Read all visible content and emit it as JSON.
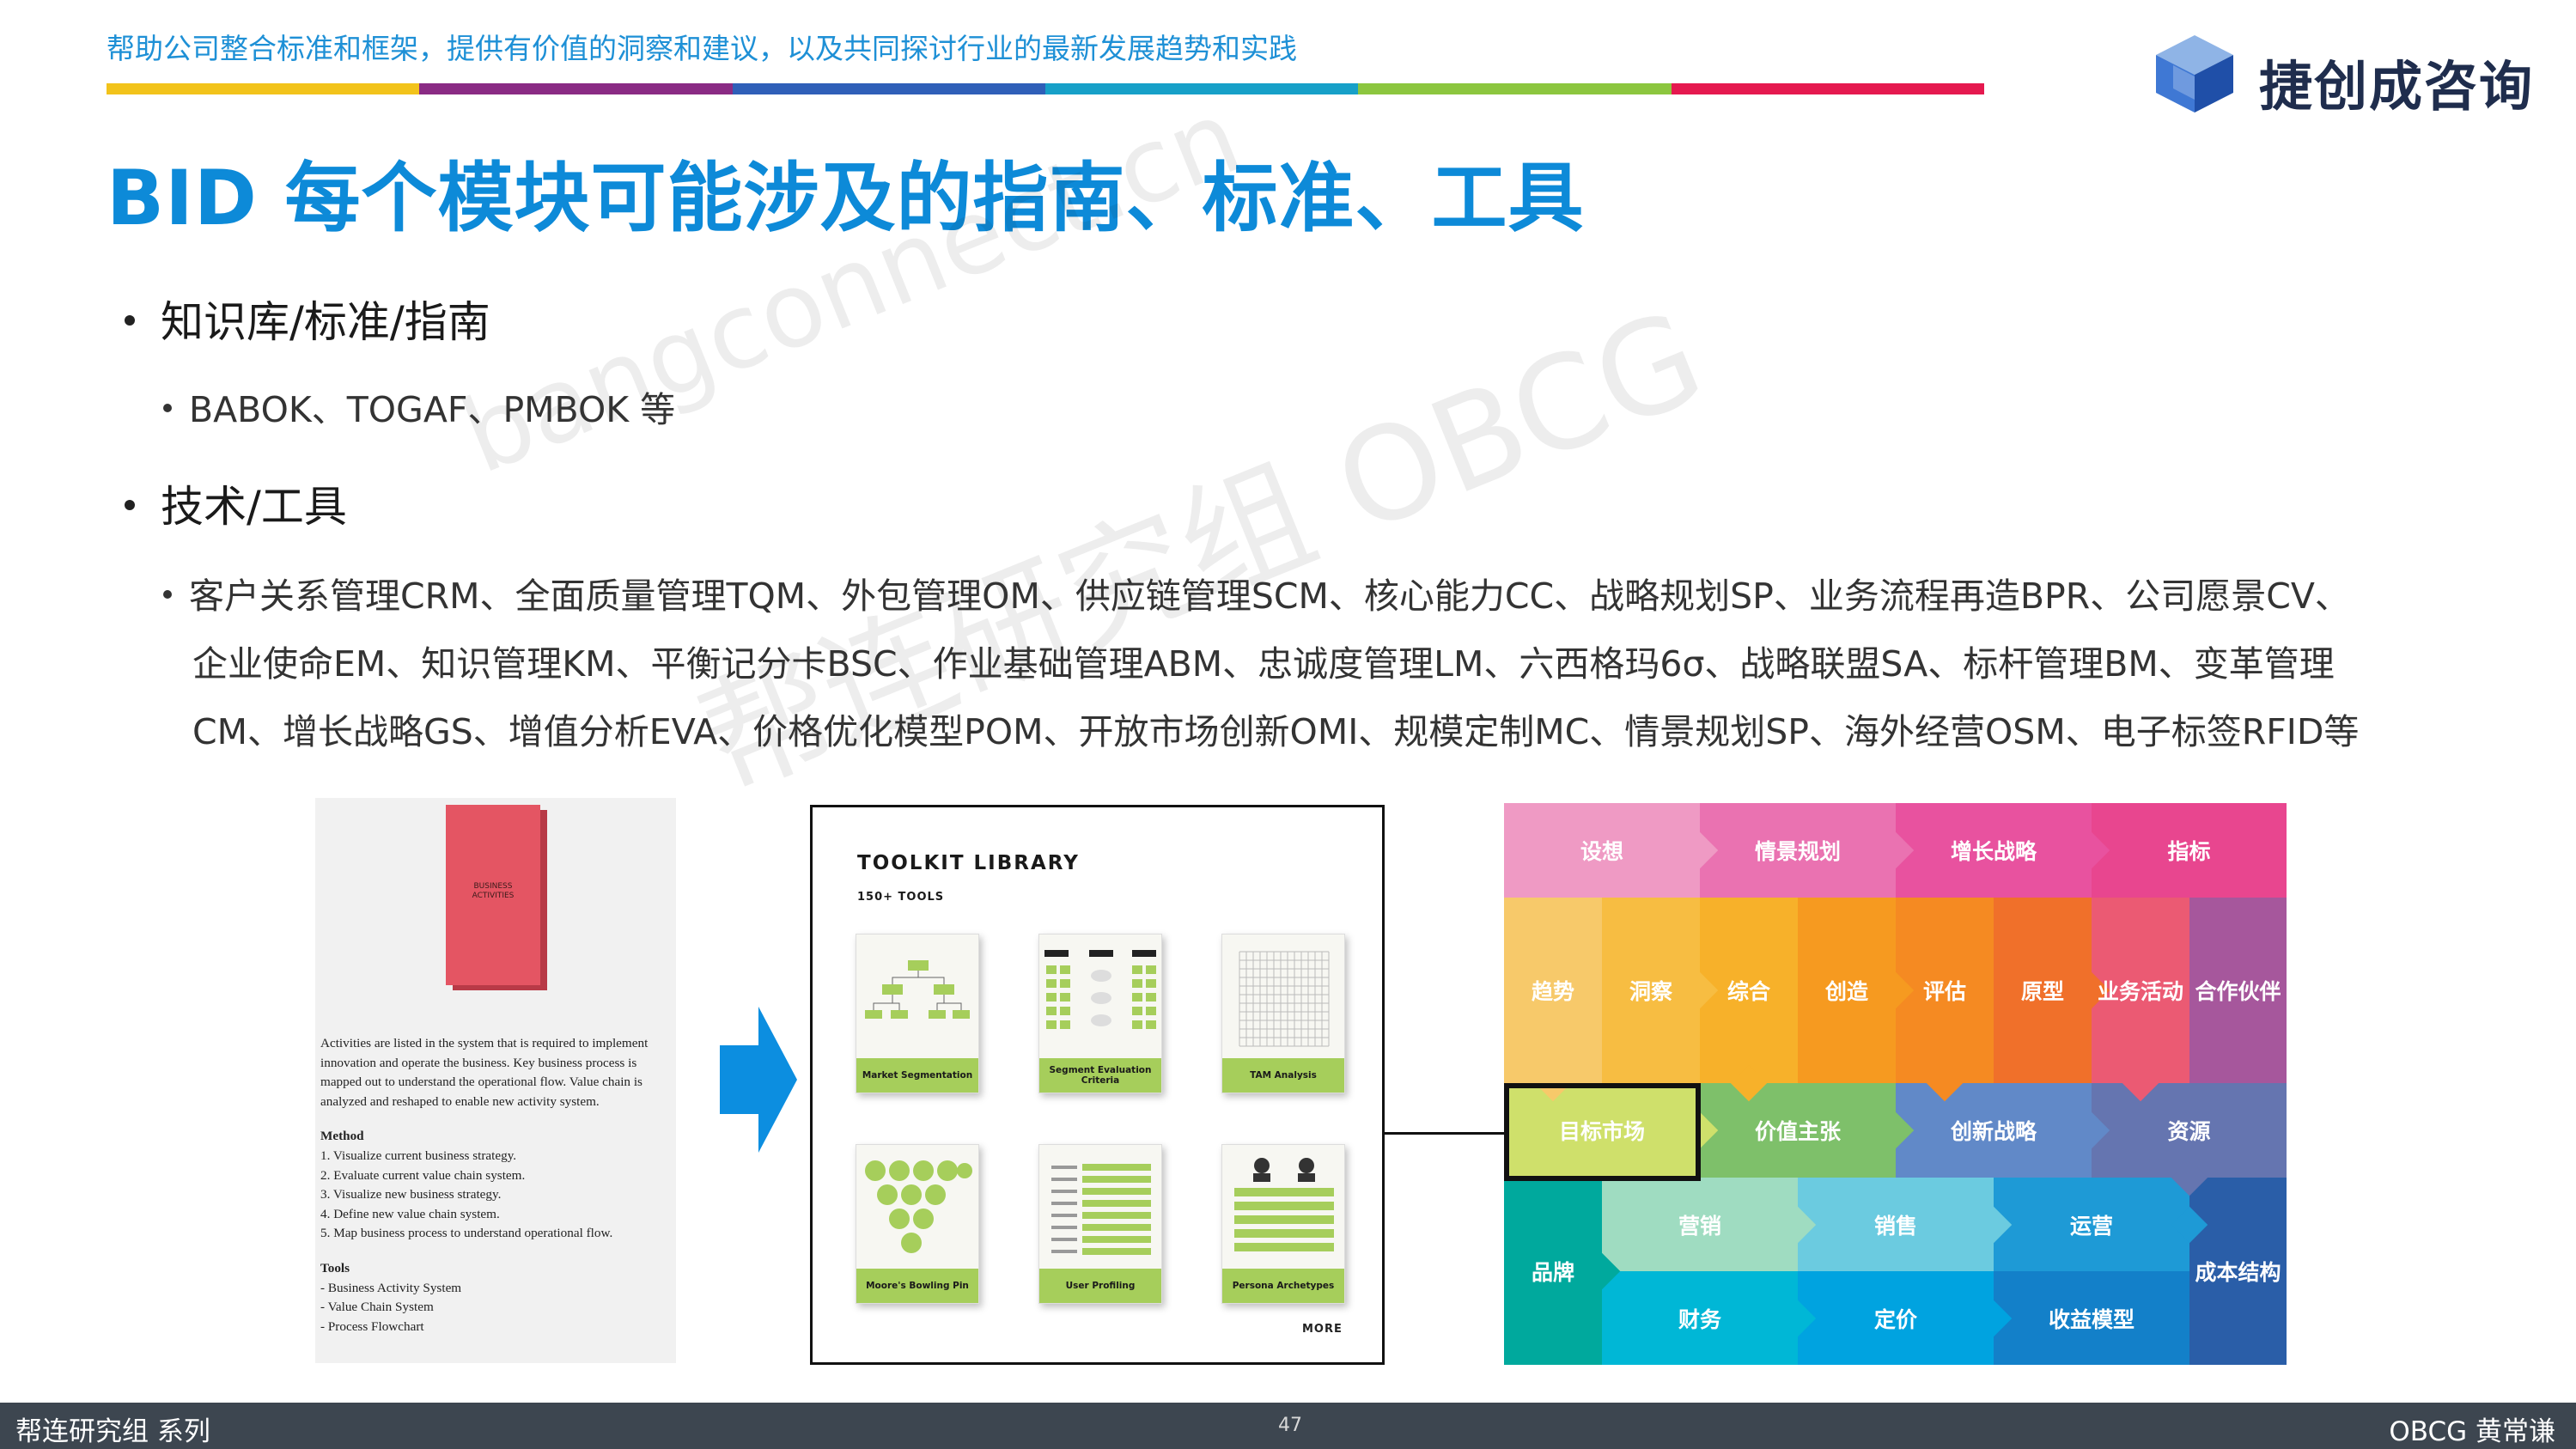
{
  "header": {
    "tagline": "帮助公司整合标准和框架，提供有价值的洞察和建议，以及共同探讨行业的最新发展趋势和实践",
    "color_bar": [
      "#f2c31b",
      "#8a2b84",
      "#2f5fb8",
      "#17a0c8",
      "#8cc63f",
      "#e5194f"
    ],
    "logo_text": "捷创成咨询"
  },
  "title": "BID 每个模块可能涉及的指南、标准、工具",
  "watermarks": [
    "bangconnect.cn",
    "帮连研究组 OBCG"
  ],
  "bullets": {
    "knowledge_heading": "知识库/标准/指南",
    "knowledge_item": "BABOK、TOGAF、PMBOK 等",
    "tools_heading": "技术/工具",
    "tools_lines": [
      "客户关系管理CRM、全面质量管理TQM、外包管理OM、供应链管理SCM、核心能力CC、战略规划SP、业务流程再造BPR、公司愿景CV、",
      "企业使命EM、知识管理KM、平衡记分卡BSC、作业基础管理ABM、忠诚度管理LM、六西格玛6σ、战略联盟SA、标杆管理BM、变革管理",
      "CM、增长战略GS、增值分析EVA、价格优化模型POM、开放市场创新OMI、规模定制MC、情景规划SP、海外经营OSM、电子标签RFID等"
    ]
  },
  "left_panel": {
    "box_label": "BUSINESS\nACTIVITIES",
    "description": "Activities are listed in the system that is required to implement innovation and operate the business. Key business process is mapped out to understand the operational flow. Value chain is analyzed and reshaped to enable new activity system.",
    "method_heading": "Method",
    "method_items": [
      "1. Visualize current business strategy.",
      "2. Evaluate current value chain system.",
      "3. Visualize new business strategy.",
      "4. Define new value chain system.",
      "5. Map business process to understand operational flow."
    ],
    "tools_heading": "Tools",
    "tools_items": [
      "- Business Activity System",
      "- Value Chain System",
      "- Process Flowchart"
    ]
  },
  "toolkit": {
    "title": "TOOLKIT LIBRARY",
    "subtitle": "150+ TOOLS",
    "cards": [
      "Market Segmentation",
      "Segment Evaluation Criteria",
      "TAM Analysis",
      "Moore's Bowling Pin",
      "User Profiling",
      "Persona Archetypes"
    ],
    "more": "MORE"
  },
  "puzzle": {
    "row1": [
      "设想",
      "情景规划",
      "增长战略",
      "指标"
    ],
    "row2": [
      "趋势",
      "洞察",
      "综合",
      "创造",
      "评估",
      "原型",
      "业务活动",
      "合作伙伴"
    ],
    "row3": [
      "目标市场",
      "价值主张",
      "创新战略",
      "资源"
    ],
    "row4": [
      "品牌",
      "营销",
      "销售",
      "运营",
      "成本结构"
    ],
    "row5": [
      "财务",
      "定价",
      "收益模型"
    ],
    "colors": {
      "row1": [
        "#ef9ac4",
        "#ea72b1",
        "#e8529f",
        "#e8468f"
      ],
      "row2": [
        "#f7c96a",
        "#f7bd42",
        "#f7b12a",
        "#f69a20",
        "#f58a22",
        "#f0702a",
        "#eb5a73",
        "#a6579c"
      ],
      "row3": [
        "#cfe06b",
        "#7ec06a",
        "#6189c8",
        "#6575b0"
      ],
      "row4": [
        "#00a99d",
        "#9fdcc1",
        "#6bcbe0",
        "#1e9ad6",
        "#2a5ea8"
      ],
      "row5": [
        "#00b7d6",
        "#00a3e0",
        "#1380c9"
      ]
    }
  },
  "footer": {
    "left": "帮连研究组 系列",
    "page": "47",
    "right": "OBCG 黄常谦"
  }
}
